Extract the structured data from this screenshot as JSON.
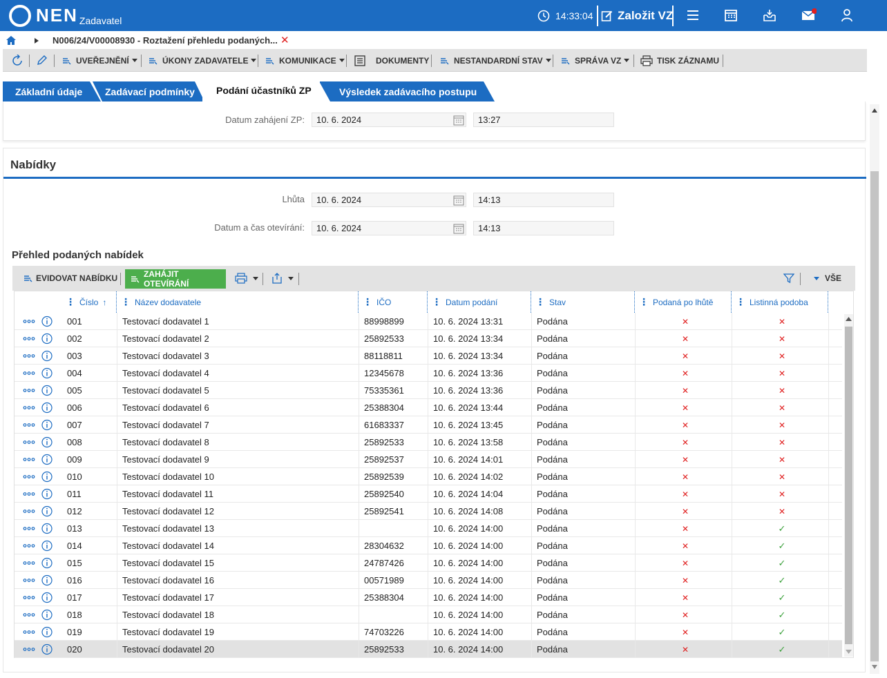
{
  "header": {
    "logo_text": "NEN",
    "logo_sub": "Zadavatel",
    "time": "14:33:04",
    "new_button": "Založit VZ",
    "icons": [
      "menu-icon",
      "calendar-icon",
      "inbox-icon",
      "mail-icon",
      "user-icon"
    ],
    "colors": {
      "brand": "#1c6cc2",
      "notification": "#e02020"
    }
  },
  "breadcrumb": {
    "path": "N006/24/V00008930 - Roztažení přehledu podaných..."
  },
  "toolbar": {
    "items": [
      {
        "label": "UVEŘEJNĚNÍ",
        "icon": "list-icon"
      },
      {
        "label": "ÚKONY ZADAVATELE",
        "icon": "list-icon"
      },
      {
        "label": "KOMUNIKACE",
        "icon": "list-icon"
      },
      {
        "label": "DOKUMENTY",
        "icon": "document-icon"
      },
      {
        "label": "NESTANDARDNÍ STAV",
        "icon": "list-icon"
      },
      {
        "label": "SPRÁVA VZ",
        "icon": "list-icon"
      },
      {
        "label": "TISK ZÁZNAMU",
        "icon": "printer-icon"
      }
    ]
  },
  "tabs": [
    {
      "label": "Základní údaje"
    },
    {
      "label": "Zadávací podmínky"
    },
    {
      "label": "Podání účastníků ZP",
      "active": true
    },
    {
      "label": "Výsledek zadávacího postupu"
    }
  ],
  "start": {
    "label": "Datum zahájení ZP:",
    "date": "10. 6. 2024",
    "time": "13:27"
  },
  "offers": {
    "title": "Nabídky",
    "deadline_label": "Lhůta",
    "deadline_date": "10. 6. 2024",
    "deadline_time": "14:13",
    "opening_label": "Datum a čas otevírání:",
    "opening_date": "10. 6. 2024",
    "opening_time": "14:13"
  },
  "grid": {
    "title": "Přehled podaných nabídek",
    "btn_register": "EVIDOVAT NABÍDKU",
    "btn_open": "ZAHÁJIT OTEVÍRÁNÍ",
    "filter_label": "VŠE",
    "columns": {
      "num": "Číslo",
      "name": "Název dodavatele",
      "ico": "IČO",
      "date": "Datum podání",
      "state": "Stav",
      "late": "Podaná po lhůtě",
      "paper": "Listinná podoba"
    },
    "rows": [
      {
        "num": "001",
        "name": "Testovací dodavatel 1",
        "ico": "88998899",
        "date": "10. 6. 2024 13:31",
        "state": "Podána",
        "late": false,
        "paper": false
      },
      {
        "num": "002",
        "name": "Testovací dodavatel 2",
        "ico": "25892533",
        "date": "10. 6. 2024 13:34",
        "state": "Podána",
        "late": false,
        "paper": false
      },
      {
        "num": "003",
        "name": "Testovací dodavatel 3",
        "ico": "88118811",
        "date": "10. 6. 2024 13:34",
        "state": "Podána",
        "late": false,
        "paper": false
      },
      {
        "num": "004",
        "name": "Testovací dodavatel 4",
        "ico": "12345678",
        "date": "10. 6. 2024 13:36",
        "state": "Podána",
        "late": false,
        "paper": false
      },
      {
        "num": "005",
        "name": "Testovací dodavatel 5",
        "ico": "75335361",
        "date": "10. 6. 2024 13:36",
        "state": "Podána",
        "late": false,
        "paper": false
      },
      {
        "num": "006",
        "name": "Testovací dodavatel 6",
        "ico": "25388304",
        "date": "10. 6. 2024 13:44",
        "state": "Podána",
        "late": false,
        "paper": false
      },
      {
        "num": "007",
        "name": "Testovací dodavatel 7",
        "ico": "61683337",
        "date": "10. 6. 2024 13:45",
        "state": "Podána",
        "late": false,
        "paper": false
      },
      {
        "num": "008",
        "name": "Testovací dodavatel 8",
        "ico": "25892533",
        "date": "10. 6. 2024 13:58",
        "state": "Podána",
        "late": false,
        "paper": false
      },
      {
        "num": "009",
        "name": "Testovací dodavatel 9",
        "ico": "25892537",
        "date": "10. 6. 2024 14:01",
        "state": "Podána",
        "late": false,
        "paper": false
      },
      {
        "num": "010",
        "name": "Testovací dodavatel 10",
        "ico": "25892539",
        "date": "10. 6. 2024 14:02",
        "state": "Podána",
        "late": false,
        "paper": false
      },
      {
        "num": "011",
        "name": "Testovací dodavatel 11",
        "ico": "25892540",
        "date": "10. 6. 2024 14:04",
        "state": "Podána",
        "late": false,
        "paper": false
      },
      {
        "num": "012",
        "name": "Testovací dodavatel 12",
        "ico": "25892541",
        "date": "10. 6. 2024 14:08",
        "state": "Podána",
        "late": false,
        "paper": false
      },
      {
        "num": "013",
        "name": "Testovací dodavatel 13",
        "ico": "",
        "date": "10. 6. 2024 14:00",
        "state": "Podána",
        "late": false,
        "paper": true
      },
      {
        "num": "014",
        "name": "Testovací dodavatel 14",
        "ico": "28304632",
        "date": "10. 6. 2024 14:00",
        "state": "Podána",
        "late": false,
        "paper": true
      },
      {
        "num": "015",
        "name": "Testovací dodavatel 15",
        "ico": "24787426",
        "date": "10. 6. 2024 14:00",
        "state": "Podána",
        "late": false,
        "paper": true
      },
      {
        "num": "016",
        "name": "Testovací dodavatel 16",
        "ico": "00571989",
        "date": "10. 6. 2024 14:00",
        "state": "Podána",
        "late": false,
        "paper": true
      },
      {
        "num": "017",
        "name": "Testovací dodavatel 17",
        "ico": "25388304",
        "date": "10. 6. 2024 14:00",
        "state": "Podána",
        "late": false,
        "paper": true
      },
      {
        "num": "018",
        "name": "Testovací dodavatel 18",
        "ico": "",
        "date": "10. 6. 2024 14:00",
        "state": "Podána",
        "late": false,
        "paper": true
      },
      {
        "num": "019",
        "name": "Testovací dodavatel 19",
        "ico": "74703226",
        "date": "10. 6. 2024 14:00",
        "state": "Podána",
        "late": false,
        "paper": true
      },
      {
        "num": "020",
        "name": "Testovací dodavatel 20",
        "ico": "25892533",
        "date": "10. 6. 2024 14:00",
        "state": "Podána",
        "late": false,
        "paper": true,
        "selected": true
      }
    ]
  }
}
